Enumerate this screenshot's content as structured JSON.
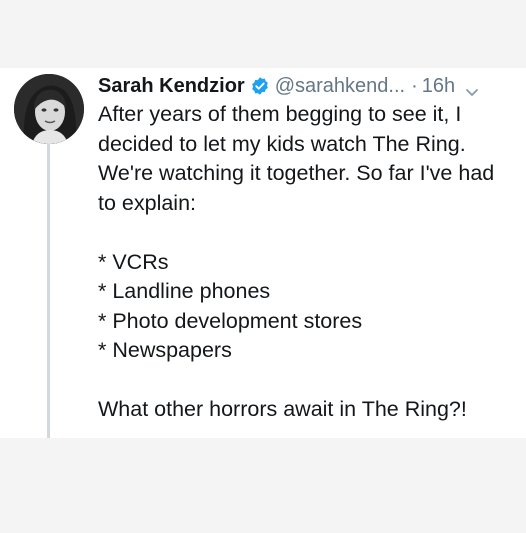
{
  "tweet": {
    "display_name": "Sarah Kendzior",
    "handle": "@sarahkend...",
    "separator": "·",
    "time": "16h",
    "verified_icon": "verified-badge-icon",
    "menu_icon": "chevron-down-icon",
    "avatar_icon": "avatar",
    "accent_color": "#1da1f2",
    "lines": {
      "intro1": "After years of them begging to see it, I",
      "intro2": "decided to let my kids watch The Ring.",
      "intro3": "We're watching it together. So far I've had",
      "intro4": "to explain:",
      "item1": "* VCRs",
      "item2": "* Landline phones",
      "item3": "* Photo development stores",
      "item4": "* Newspapers",
      "closing": "What other horrors await in The Ring?!"
    }
  }
}
